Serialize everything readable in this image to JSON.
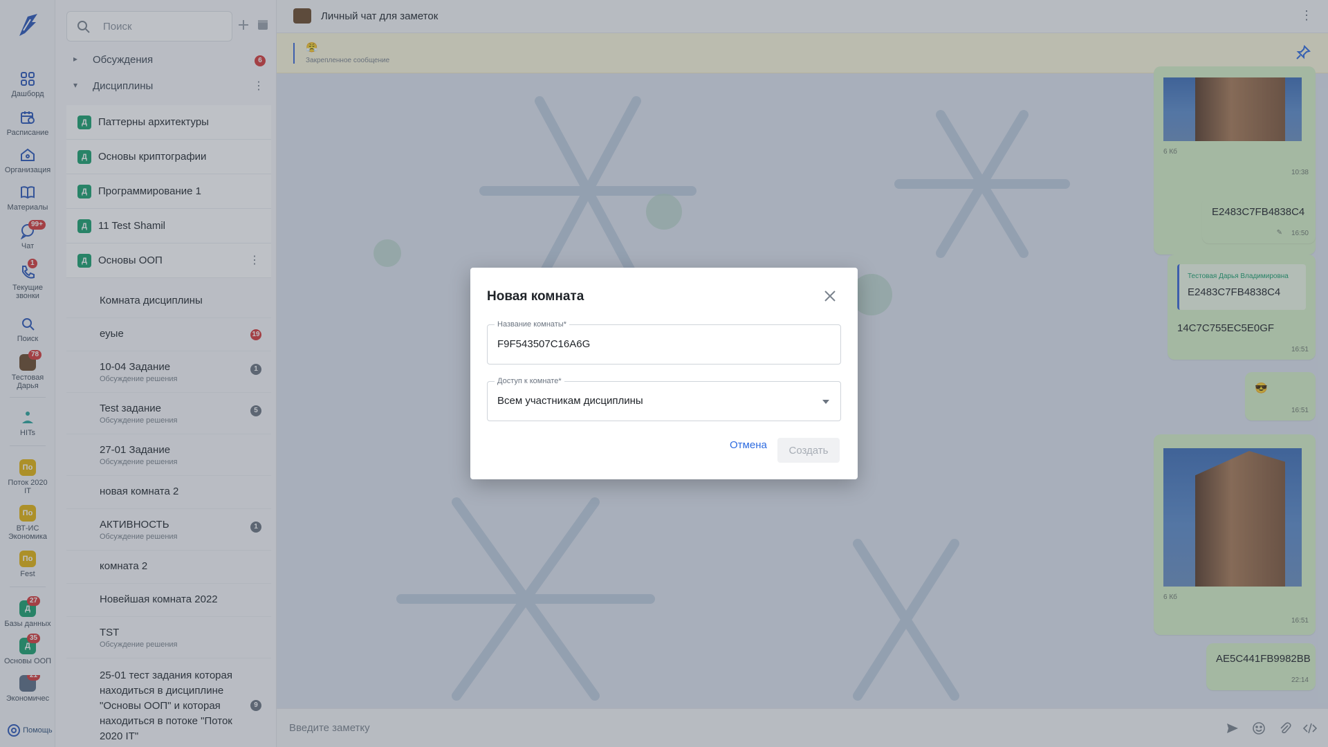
{
  "rail": {
    "items": [
      {
        "label": "Дашборд"
      },
      {
        "label": "Расписание"
      },
      {
        "label": "Организация"
      },
      {
        "label": "Материалы"
      },
      {
        "label": "Чат",
        "badge": "99+"
      },
      {
        "label": "Текущие звонки",
        "badge": "1"
      },
      {
        "label": "Поиск"
      },
      {
        "label": "Тестовая Дарья",
        "badge": "78"
      },
      {
        "label": "HITs"
      },
      {
        "label": "Поток 2020 IT",
        "abbr": "По"
      },
      {
        "label": "ВТ-ИС Экономика",
        "abbr": "По"
      },
      {
        "label": "Fest",
        "abbr": "По"
      },
      {
        "label": "Базы данных",
        "abbr": "Д",
        "badge": "27"
      },
      {
        "label": "Основы ООП",
        "abbr": "Д",
        "badge": "35"
      },
      {
        "label": "Экономичес",
        "badge": "21"
      }
    ],
    "help": "Помощь"
  },
  "list": {
    "search_placeholder": "Поиск",
    "groups": [
      {
        "label": "Обсуждения",
        "count": "6"
      },
      {
        "label": "Дисциплины"
      }
    ],
    "disciplines": [
      {
        "icon": "Д",
        "label": "Паттерны архитектуры"
      },
      {
        "icon": "Д",
        "label": "Основы криптографии"
      },
      {
        "icon": "Д",
        "label": "Программирование 1"
      },
      {
        "icon": "Д",
        "label": "11 Test Shamil"
      },
      {
        "icon": "Д",
        "label": "Основы ООП"
      }
    ],
    "rooms": [
      {
        "title": "Комната дисциплины"
      },
      {
        "title": "еуые",
        "count": "19"
      },
      {
        "title": "10-04 Задание",
        "sub": "Обсуждение решения",
        "count": "1"
      },
      {
        "title": "Test задание",
        "sub": "Обсуждение решения",
        "count": "5"
      },
      {
        "title": "27-01 Задание",
        "sub": "Обсуждение решения"
      },
      {
        "title": "новая комната 2"
      },
      {
        "title": "АКТИВНОСТЬ",
        "sub": "Обсуждение решения",
        "count": "1"
      },
      {
        "title": "комната 2"
      },
      {
        "title": "Новейшая комната 2022"
      },
      {
        "title": "TST",
        "sub": "Обсуждение решения"
      },
      {
        "title": "25-01 тест задания которая находиться в дисциплине \"Основы ООП\" и которая находиться в потоке \"Поток 2020 IT\"",
        "count": "9"
      }
    ]
  },
  "chat": {
    "title": "Личный чат для заметок",
    "pinned": {
      "emoji": "😤",
      "label": "Закрепленное сообщение"
    },
    "messages": [
      {
        "size": "6 Кб",
        "time": "10:38"
      },
      {
        "text": "E2483C7FB4838C4",
        "time": "16:50"
      },
      {
        "quote_author": "Тестовая Дарья Владимировна",
        "quote_text": "E2483C7FB4838C4",
        "text": "14C7C755EC5E0GF",
        "time": "16:51"
      },
      {
        "text": "😎",
        "time": "16:51"
      },
      {
        "size": "6 Кб",
        "time": "16:51"
      },
      {
        "text": "AE5C441FB9982BB",
        "time": "22:14"
      }
    ],
    "composer_placeholder": "Введите заметку"
  },
  "modal": {
    "title": "Новая комната",
    "name_label": "Название комнаты*",
    "name_value": "F9F543507C16A6G",
    "access_label": "Доступ к комнате*",
    "access_value": "Всем участникам дисциплины",
    "cancel": "Отмена",
    "create": "Создать"
  },
  "colors": {
    "accent": "#2d6be0",
    "bubble": "#d8f1c8",
    "badge": "#d63a3a",
    "discipline": "#1aa06d",
    "stream": "#e4b40f"
  }
}
